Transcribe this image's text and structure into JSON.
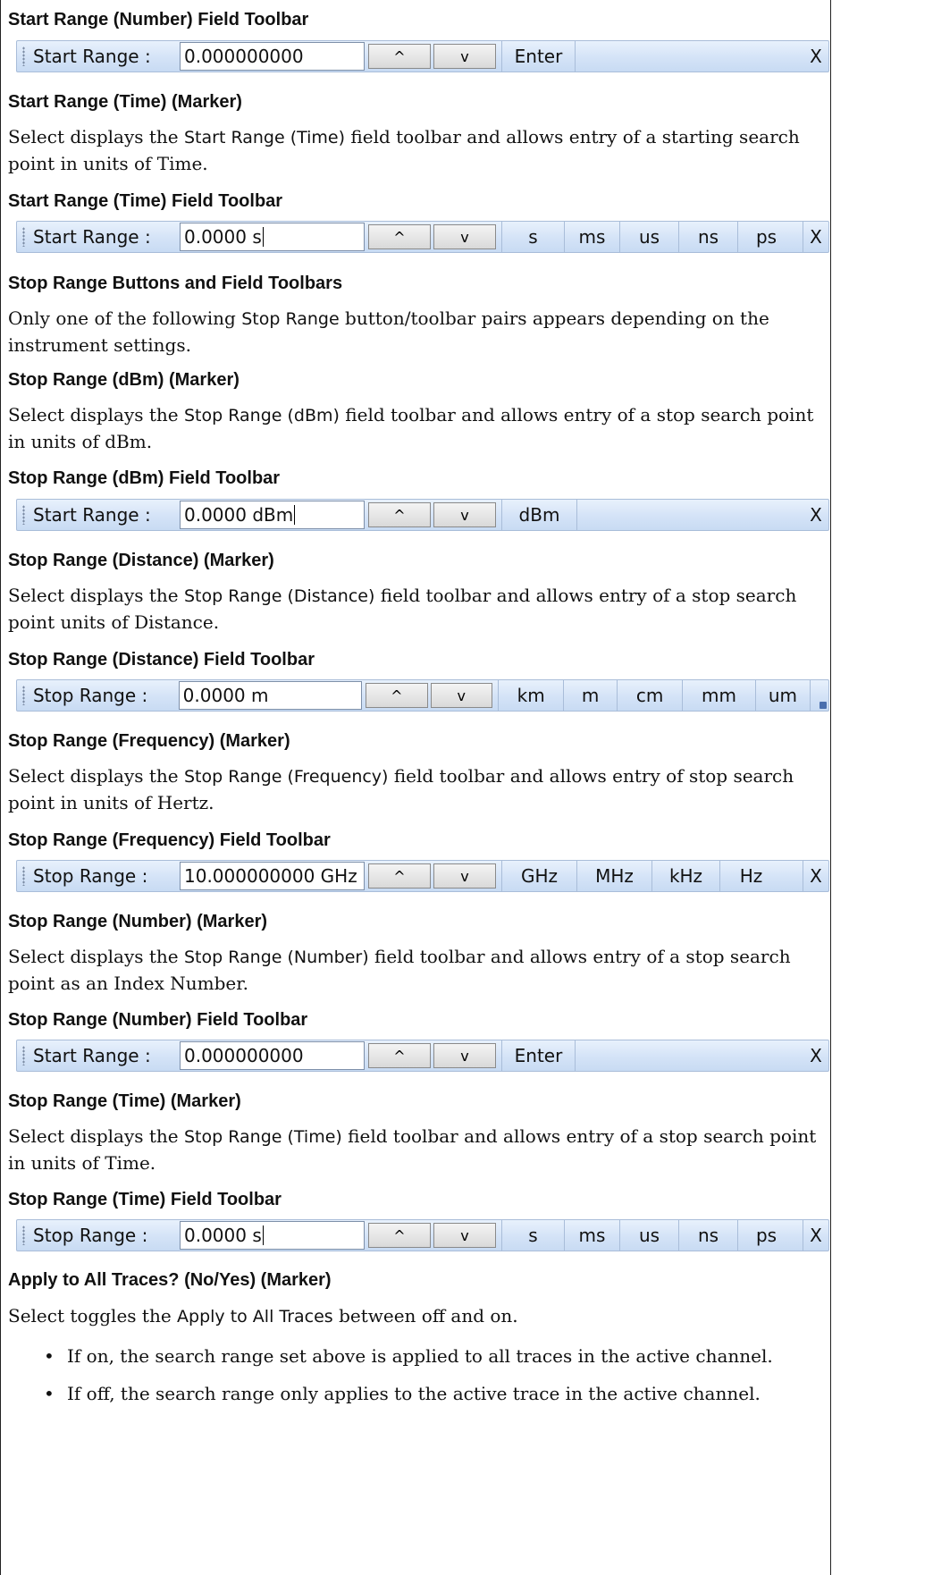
{
  "headings": {
    "h1": "Start Range (Number) Field Toolbar",
    "h2": "Start Range (Time) (Marker)",
    "h3": "Start Range (Time) Field Toolbar",
    "h4": "Stop Range Buttons and Field Toolbars",
    "h5": "Stop Range (dBm) (Marker)",
    "h6": "Stop Range (dBm) Field Toolbar",
    "h7": "Stop Range (Distance) (Marker)",
    "h8": "Stop Range (Distance) Field Toolbar",
    "h9": "Stop Range (Frequency) (Marker)",
    "h10": "Stop Range (Frequency) Field Toolbar",
    "h11": "Stop Range (Number) (Marker)",
    "h12": "Stop Range (Number) Field Toolbar",
    "h13": "Stop Range (Time) (Marker)",
    "h14": "Stop Range (Time) Field Toolbar",
    "h15": "Apply to All Traces? (No/Yes) (Marker)"
  },
  "paragraphs": {
    "p_start_time": {
      "a": "Select displays the ",
      "ui": "Start Range (Time)",
      "b": " field toolbar and allows entry of a starting search point in units of Time."
    },
    "p_stop_intro": {
      "a": "Only one of the following ",
      "ui": "Stop Range",
      "b": " button/toolbar pairs appears depending on the instrument settings."
    },
    "p_stop_dbm": {
      "a": "Select displays the ",
      "ui": "Stop Range (dBm)",
      "b": " field toolbar and allows entry of a stop search point in units of dBm."
    },
    "p_stop_dist": {
      "a": "Select displays the ",
      "ui": "Stop Range (Distance)",
      "b": " field toolbar and allows entry of a stop search point units of Distance."
    },
    "p_stop_freq": {
      "a": "Select displays the ",
      "ui": "Stop Range (Frequency)",
      "b": " field toolbar and allows entry of stop search point in units of Hertz."
    },
    "p_stop_num": {
      "a": "Select displays the ",
      "ui": "Stop Range (Number)",
      "b": " field toolbar and allows entry of a stop search point as an Index Number."
    },
    "p_stop_time": {
      "a": "Select displays the ",
      "ui": "Stop Range (Time)",
      "b": " field toolbar and allows entry of a stop search point in units of Time."
    },
    "p_apply": {
      "a": "Select toggles the ",
      "ui": "Apply to All Traces",
      "b": " between off and on."
    }
  },
  "bullets": [
    "If on, the search range set above is applied to all traces in the active channel.",
    "If off, the search range only applies to the active trace in the active channel."
  ],
  "bullet_char": "•",
  "toolbars": {
    "tb1": {
      "label": "Start Range :",
      "value": "0.000000000",
      "up": "^",
      "down": "v",
      "units": [
        "Enter"
      ],
      "close": "X"
    },
    "tb2": {
      "label": "Start Range :",
      "value": "0.0000  s",
      "up": "^",
      "down": "v",
      "units": [
        "s",
        "ms",
        "us",
        "ns",
        "ps"
      ],
      "close": "X"
    },
    "tb3": {
      "label": "Start Range :",
      "value": "0.0000  dBm",
      "up": "^",
      "down": "v",
      "units": [
        "dBm"
      ],
      "close": "X"
    },
    "tb4": {
      "label": "Stop Range :",
      "value": "0.0000  m",
      "up": "^",
      "down": "v",
      "units": [
        "km",
        "m",
        "cm",
        "mm",
        "um"
      ]
    },
    "tb5": {
      "label": "Stop Range :",
      "value": "10.000000000 GHz",
      "up": "^",
      "down": "v",
      "units": [
        "GHz",
        "MHz",
        "kHz",
        "Hz"
      ],
      "close": "X"
    },
    "tb6": {
      "label": "Start Range :",
      "value": "0.000000000",
      "up": "^",
      "down": "v",
      "units": [
        "Enter"
      ],
      "close": "X"
    },
    "tb7": {
      "label": "Stop Range :",
      "value": "0.0000  s",
      "up": "^",
      "down": "v",
      "units": [
        "s",
        "ms",
        "us",
        "ns",
        "ps"
      ],
      "close": "X"
    }
  },
  "colors": {
    "toolbar_bg": "#d4e3f7",
    "toolbar_border": "#a9bdd9",
    "overflow_icon": "#4a6fae"
  }
}
